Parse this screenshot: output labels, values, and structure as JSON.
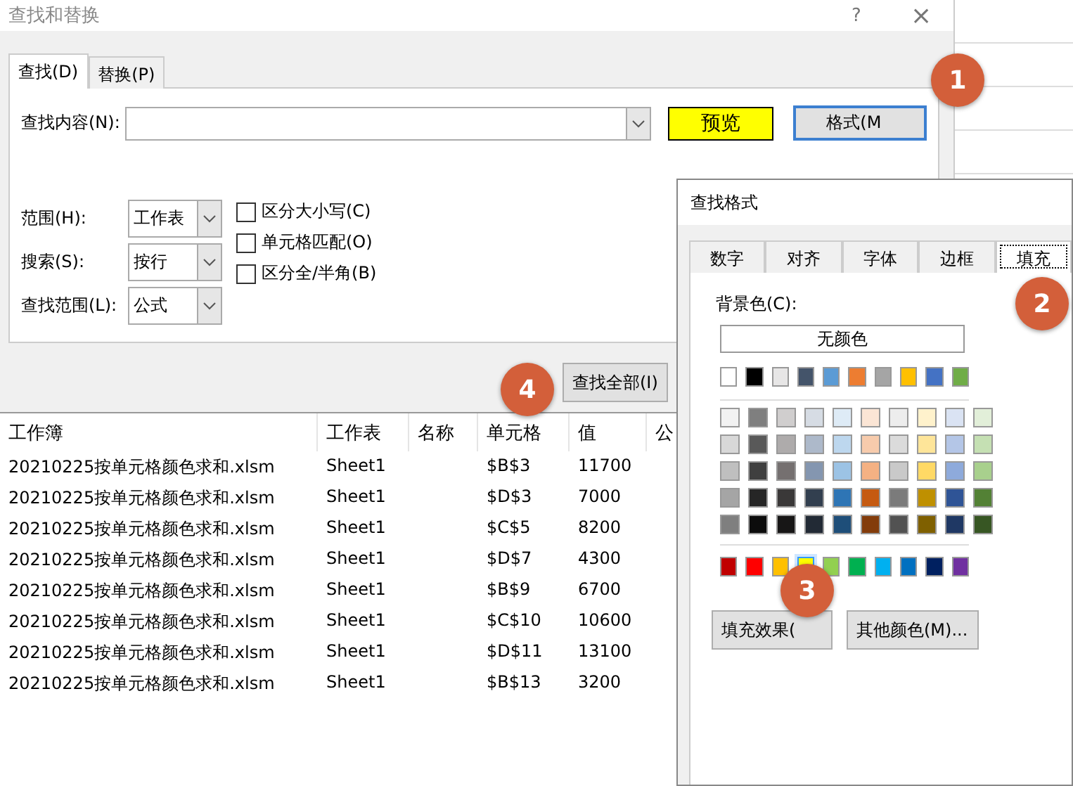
{
  "find_replace_dialog": {
    "title": "查找和替换",
    "help": "?",
    "close": "×",
    "tabs": [
      {
        "label": "查找(D)",
        "selected": true
      },
      {
        "label": "替换(P)",
        "selected": false
      }
    ],
    "find_what": {
      "label": "查找内容(N):"
    },
    "preview": {
      "label": "预览",
      "color": "#ffff00"
    },
    "format_button": "格式(M",
    "options": [
      {
        "label": "范围(H):",
        "value": "工作表"
      },
      {
        "label": "搜索(S):",
        "value": "按行"
      },
      {
        "label": "查找范围(L):",
        "value": "公式"
      }
    ],
    "checkboxes": [
      {
        "label": "区分大小写(C)",
        "checked": false
      },
      {
        "label": "单元格匹配(O)",
        "checked": false
      },
      {
        "label": "区分全/半角(B)",
        "checked": false
      }
    ],
    "find_all_button": "查找全部(I)",
    "results": {
      "columns": [
        "工作簿",
        "工作表",
        "名称",
        "单元格",
        "值",
        "公"
      ],
      "rows": [
        [
          "20210225按单元格颜色求和.xlsm",
          "Sheet1",
          "",
          "$B$3",
          "11700"
        ],
        [
          "20210225按单元格颜色求和.xlsm",
          "Sheet1",
          "",
          "$D$3",
          "7000"
        ],
        [
          "20210225按单元格颜色求和.xlsm",
          "Sheet1",
          "",
          "$C$5",
          "8200"
        ],
        [
          "20210225按单元格颜色求和.xlsm",
          "Sheet1",
          "",
          "$D$7",
          "4300"
        ],
        [
          "20210225按单元格颜色求和.xlsm",
          "Sheet1",
          "",
          "$B$9",
          "6700"
        ],
        [
          "20210225按单元格颜色求和.xlsm",
          "Sheet1",
          "",
          "$C$10",
          "10600"
        ],
        [
          "20210225按单元格颜色求和.xlsm",
          "Sheet1",
          "",
          "$D$11",
          "13100"
        ],
        [
          "20210225按单元格颜色求和.xlsm",
          "Sheet1",
          "",
          "$B$13",
          "3200"
        ]
      ]
    }
  },
  "find_format_dialog": {
    "title": "查找格式",
    "tabs": [
      {
        "label": "数字",
        "selected": false
      },
      {
        "label": "对齐",
        "selected": false
      },
      {
        "label": "字体",
        "selected": false
      },
      {
        "label": "边框",
        "selected": false
      },
      {
        "label": "填充",
        "selected": true
      }
    ],
    "background_label": "背景色(C):",
    "no_color_button": "无颜色",
    "palette_rows": [
      {
        "kind": "theme",
        "swatches": [
          {
            "color": "#ffffff",
            "selected": false
          },
          {
            "color": "#000000",
            "selected": false
          },
          {
            "color": "#e7e6e6",
            "selected": false
          },
          {
            "color": "#44546a",
            "selected": false
          },
          {
            "color": "#5b9bd5",
            "selected": false
          },
          {
            "color": "#ed7d31",
            "selected": false
          },
          {
            "color": "#a5a5a5",
            "selected": false
          },
          {
            "color": "#ffc000",
            "selected": false
          },
          {
            "color": "#4472c4",
            "selected": false
          },
          {
            "color": "#70ad47",
            "selected": false
          }
        ]
      },
      {
        "kind": "shade",
        "swatches": [
          {
            "color": "#f2f2f2",
            "selected": false
          },
          {
            "color": "#7f7f7f",
            "selected": false
          },
          {
            "color": "#d0cece",
            "selected": false
          },
          {
            "color": "#d6dce4",
            "selected": false
          },
          {
            "color": "#deebf6",
            "selected": false
          },
          {
            "color": "#fbe5d5",
            "selected": false
          },
          {
            "color": "#ededed",
            "selected": false
          },
          {
            "color": "#fff2cc",
            "selected": false
          },
          {
            "color": "#dae3f3",
            "selected": false
          },
          {
            "color": "#e2efd9",
            "selected": false
          }
        ]
      },
      {
        "kind": "shade",
        "swatches": [
          {
            "color": "#d8d8d8",
            "selected": false
          },
          {
            "color": "#595959",
            "selected": false
          },
          {
            "color": "#aeabab",
            "selected": false
          },
          {
            "color": "#adb9ca",
            "selected": false
          },
          {
            "color": "#bdd7ee",
            "selected": false
          },
          {
            "color": "#f7cbac",
            "selected": false
          },
          {
            "color": "#dbdbdb",
            "selected": false
          },
          {
            "color": "#fee599",
            "selected": false
          },
          {
            "color": "#b4c6e7",
            "selected": false
          },
          {
            "color": "#c5e0b3",
            "selected": false
          }
        ]
      },
      {
        "kind": "shade",
        "swatches": [
          {
            "color": "#bfbfbf",
            "selected": false
          },
          {
            "color": "#3f3f3f",
            "selected": false
          },
          {
            "color": "#757070",
            "selected": false
          },
          {
            "color": "#8496b0",
            "selected": false
          },
          {
            "color": "#9cc3e5",
            "selected": false
          },
          {
            "color": "#f4b183",
            "selected": false
          },
          {
            "color": "#c9c9c9",
            "selected": false
          },
          {
            "color": "#ffd965",
            "selected": false
          },
          {
            "color": "#8eaadb",
            "selected": false
          },
          {
            "color": "#a8d08d",
            "selected": false
          }
        ]
      },
      {
        "kind": "shade",
        "swatches": [
          {
            "color": "#a5a5a5",
            "selected": false
          },
          {
            "color": "#262626",
            "selected": false
          },
          {
            "color": "#3a3838",
            "selected": false
          },
          {
            "color": "#323f4f",
            "selected": false
          },
          {
            "color": "#2e75b5",
            "selected": false
          },
          {
            "color": "#c55a11",
            "selected": false
          },
          {
            "color": "#7b7b7b",
            "selected": false
          },
          {
            "color": "#bf9000",
            "selected": false
          },
          {
            "color": "#2f5496",
            "selected": false
          },
          {
            "color": "#538135",
            "selected": false
          }
        ]
      },
      {
        "kind": "shade",
        "swatches": [
          {
            "color": "#7f7f7f",
            "selected": false
          },
          {
            "color": "#0c0c0c",
            "selected": false
          },
          {
            "color": "#171616",
            "selected": false
          },
          {
            "color": "#222a35",
            "selected": false
          },
          {
            "color": "#1e4e79",
            "selected": false
          },
          {
            "color": "#833c0b",
            "selected": false
          },
          {
            "color": "#525252",
            "selected": false
          },
          {
            "color": "#7f6000",
            "selected": false
          },
          {
            "color": "#1f3864",
            "selected": false
          },
          {
            "color": "#375623",
            "selected": false
          }
        ]
      },
      {
        "kind": "standard",
        "swatches": [
          {
            "color": "#c00000",
            "selected": false
          },
          {
            "color": "#ff0000",
            "selected": false
          },
          {
            "color": "#ffc000",
            "selected": false
          },
          {
            "color": "#ffff00",
            "selected": true
          },
          {
            "color": "#92d050",
            "selected": false
          },
          {
            "color": "#00b050",
            "selected": false
          },
          {
            "color": "#00b0f0",
            "selected": false
          },
          {
            "color": "#0070c0",
            "selected": false
          },
          {
            "color": "#002060",
            "selected": false
          },
          {
            "color": "#7030a0",
            "selected": false
          }
        ]
      }
    ],
    "buttons": [
      "填充效果(",
      "其他颜色(M)..."
    ]
  },
  "step_badges": [
    "1",
    "2",
    "3",
    "4"
  ]
}
